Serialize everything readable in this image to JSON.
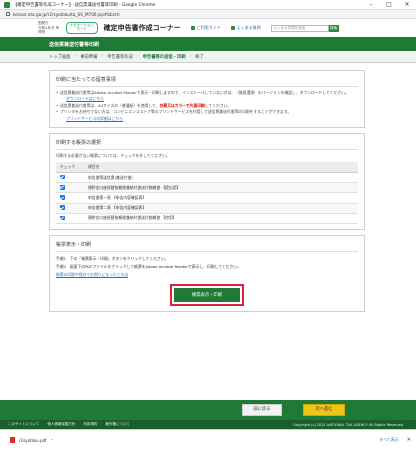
{
  "window": {
    "title": "【確定申告書等作成コーナー】-送信票兼送付書等印刷 - Google Chrome",
    "url": "keisan.nta.go.jp/r2/syotoku/ta_SS_M706.jsp#bbctrl"
  },
  "header": {
    "small_text": "国税庁\n令和2年分 所得税",
    "pill": "ナビゲーション\nモード",
    "title": "確定申告書作成コーナー",
    "link_help": "ご利用ガイド",
    "link_faq": "よくある質問",
    "search_placeholder": "よくある質問を検索",
    "search_button": "検索"
  },
  "page_heading": "送信票兼送付書等印刷",
  "breadcrumb": {
    "items": [
      "トップ画面",
      "事前準備",
      "申告書等作成",
      "申告書等の送信・印刷",
      "終了"
    ],
    "current_index": 3
  },
  "notices": {
    "title": "印刷に当たっての留意事項",
    "item1_text": "送信票兼送付書等はAdobe Acrobat Readerで表示・印刷しますので、インストールしていない方は、（推奨環境）のバージョンを確認し、ダウンロードしてください。",
    "item1_link": "ダウンロードはこちら",
    "item2_prefix": "送信票兼送付書等は、A4サイズの（普通紙）を使用して、",
    "item2_red": "白黒又はカラーで片面印刷",
    "item2_suffix": "してください。",
    "item3_text": "プリンタをお持ちでない方は、コンビニエンスストア等のプリントサービスを利用して送信票兼送付書等の印刷をすることができます。",
    "item3_link": "プリントサービスの詳細はこちら"
  },
  "form_select": {
    "title": "印刷する帳票の選択",
    "description": "印刷する必要がない帳票については、チェックを外してください。",
    "col_check": "チェック",
    "col_name": "項目名",
    "rows": [
      "申告書等送信票(兼送付書)",
      "預貯金口座振替依頼書兼納付書送付依頼書 【提出用】",
      "申告書第一表 【申告内容確認表】",
      "申告書第二表 【申告内容確認表】",
      "預貯金口座振替依頼書兼納付書送付依頼書 【控用】"
    ]
  },
  "print_section": {
    "title": "帳票表示・印刷",
    "step1": "手順1　下の「帳票表示・印刷」ボタンをクリックしてください。",
    "step2": "手順2　画面下のPDFファイルをクリックして帳票をAdobe Acrobat Readerで表示し、印刷してください。",
    "help_link": "帳票の印刷や保存でお困りになったときは",
    "print_button": "帳票表示・印刷"
  },
  "nav": {
    "back": "前に戻る",
    "next": "次へ進む"
  },
  "footer": {
    "links": [
      "このサイトについて",
      "個人情報保護方針",
      "利用規約",
      "著作権について"
    ],
    "copyright": "Copyright (c) 2021 NATIONAL TAX AGENCY All Rights Reserved."
  },
  "download": {
    "file": "r2syotoku.pdf",
    "show_all": "すべて表示"
  }
}
